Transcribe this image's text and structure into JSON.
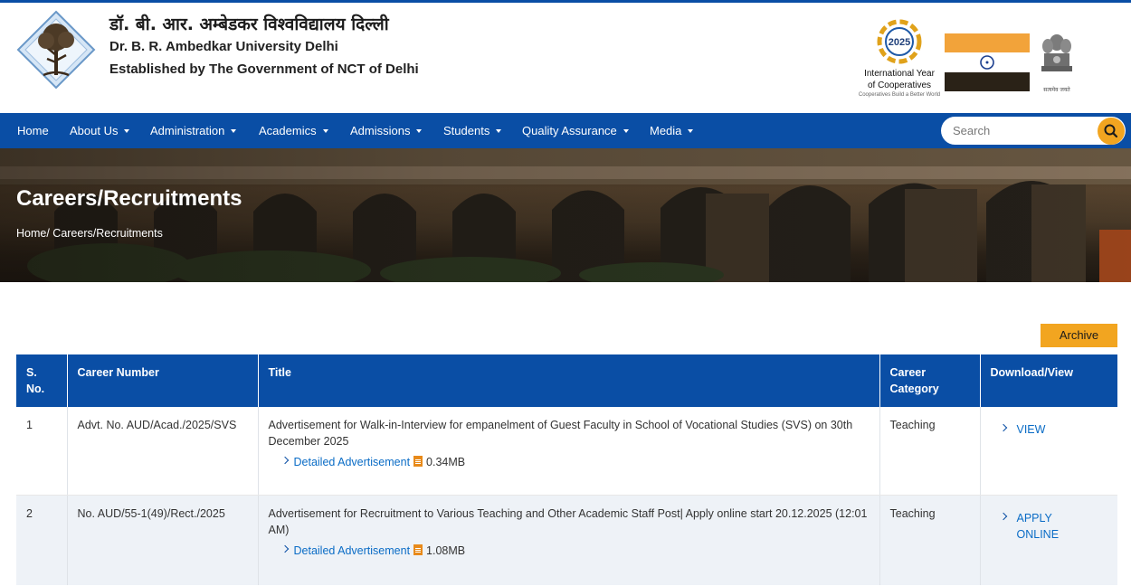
{
  "header": {
    "title_hindi": "डॉ. बी. आर. अम्बेडकर विश्वविद्यालय दिल्ली",
    "title_english": "Dr. B. R. Ambedkar University Delhi",
    "established": "Established by The Government of NCT of Delhi",
    "cooperatives": {
      "year": "2025",
      "line1": "International Year",
      "line2": "of Cooperatives",
      "tagline": "Cooperatives Build a Better World"
    },
    "emblem_text": "सत्यमेव जयते"
  },
  "nav": {
    "items": [
      {
        "label": "Home",
        "dropdown": false
      },
      {
        "label": "About Us",
        "dropdown": true
      },
      {
        "label": "Administration",
        "dropdown": true
      },
      {
        "label": "Academics",
        "dropdown": true
      },
      {
        "label": "Admissions",
        "dropdown": true
      },
      {
        "label": "Students",
        "dropdown": true
      },
      {
        "label": "Quality Assurance",
        "dropdown": true
      },
      {
        "label": "Media",
        "dropdown": true
      }
    ],
    "search_placeholder": "Search"
  },
  "banner": {
    "title": "Careers/Recruitments",
    "breadcrumb": "Home/ Careers/Recruitments"
  },
  "archive_label": "Archive",
  "table": {
    "headers": {
      "sno_line1": "S.",
      "sno_line2": "No.",
      "career_number": "Career Number",
      "title": "Title",
      "category_line1": "Career",
      "category_line2": "Category",
      "download": "Download/View"
    },
    "rows": [
      {
        "sno": "1",
        "career_number": "Advt. No. AUD/Acad./2025/SVS",
        "title": "Advertisement for Walk-in-Interview for empanelment of Guest Faculty in School of Vocational Studies (SVS) on 30th December 2025",
        "detail_label": "Detailed Advertisement",
        "size": "0.34MB",
        "category": "Teaching",
        "action_line1": "VIEW",
        "action_line2": ""
      },
      {
        "sno": "2",
        "career_number": "No. AUD/55-1(49)/Rect./2025",
        "title": "Advertisement for Recruitment to Various Teaching and Other Academic Staff Post| Apply online start 20.12.2025 (12:01 AM)",
        "detail_label": "Detailed Advertisement",
        "size": "1.08MB",
        "category": "Teaching",
        "action_line1": "APPLY",
        "action_line2": "ONLINE"
      }
    ]
  },
  "colors": {
    "primary_blue": "#0a4ea5",
    "accent_orange": "#f2a520",
    "link_blue": "#0a6cc6"
  }
}
